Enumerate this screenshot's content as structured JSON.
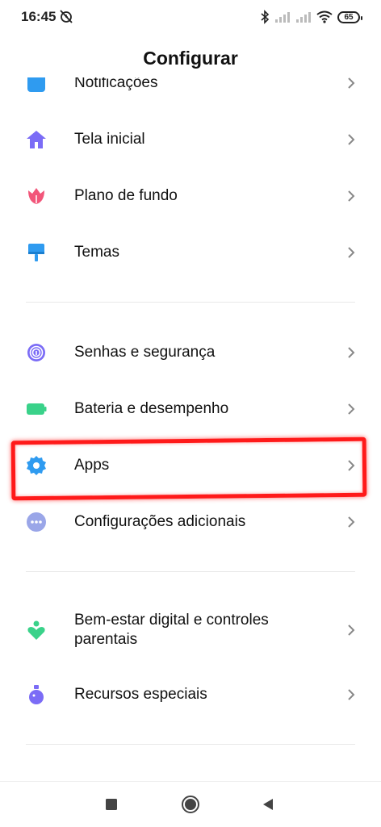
{
  "status": {
    "time": "16:45",
    "battery": "65",
    "icons": [
      "alarm-off-icon",
      "bluetooth-icon",
      "signal-icon",
      "signal-icon",
      "wifi-icon",
      "battery-icon"
    ]
  },
  "header": {
    "title": "Configurar"
  },
  "items": [
    {
      "label": "Notificações",
      "icon": "notifications-icon",
      "color": "#2f9bf0"
    },
    {
      "label": "Tela inicial",
      "icon": "home-icon",
      "color": "#7b6cf6"
    },
    {
      "label": "Plano de fundo",
      "icon": "tulip-icon",
      "color": "#f2567a"
    },
    {
      "label": "Temas",
      "icon": "brush-icon",
      "color": "#2f9bf0"
    },
    {
      "label": "Senhas e segurança",
      "icon": "fingerprint-icon",
      "color": "#7b6cf6"
    },
    {
      "label": "Bateria e desempenho",
      "icon": "battery-icon",
      "color": "#3ad28a"
    },
    {
      "label": "Apps",
      "icon": "gear-icon",
      "color": "#2f9bf0"
    },
    {
      "label": "Configurações adicionais",
      "icon": "more-icon",
      "color": "#9aa6e8"
    },
    {
      "label": "Bem-estar digital e controles parentais",
      "icon": "wellbeing-icon",
      "color": "#3ad28a"
    },
    {
      "label": "Recursos especiais",
      "icon": "flask-icon",
      "color": "#7b6cf6"
    }
  ],
  "nav": {
    "icons": [
      "recents-icon",
      "home-icon",
      "back-icon"
    ]
  },
  "colors": {
    "highlight": "#ff1a1a",
    "divider": "#e8e8e8",
    "chevron": "#888888"
  }
}
